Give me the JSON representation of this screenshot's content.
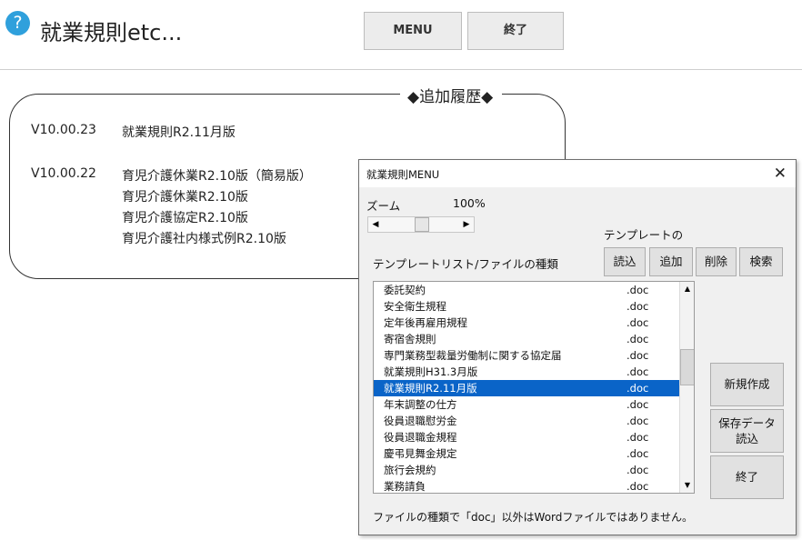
{
  "header": {
    "help_icon_glyph": "?",
    "title": "就業規則etc...",
    "menu_button": "MENU",
    "exit_button": "終了"
  },
  "history": {
    "title": "◆追加履歴◆",
    "entries": [
      {
        "version": "V10.00.23",
        "items": [
          "就業規則R2.11月版"
        ]
      },
      {
        "version": "V10.00.22",
        "items": [
          "育児介護休業R2.10版（簡易版）",
          "育児介護休業R2.10版",
          "育児介護協定R2.10版",
          "育児介護社内様式例R2.10版"
        ]
      }
    ]
  },
  "dialog": {
    "title": "就業規則MENU",
    "close_glyph": "✕",
    "zoom_label": "ズーム",
    "zoom_value": "100%",
    "zoom_left_arrow": "◀",
    "zoom_right_arrow": "▶",
    "template_group_label": "テンプレートの",
    "list_header": "テンプレートリスト/ファイルの種類",
    "buttons": {
      "read": "読込",
      "add": "追加",
      "delete": "削除",
      "search": "検索",
      "new": "新規作成",
      "load_saved_line1": "保存データ",
      "load_saved_line2": "読込",
      "close": "終了"
    },
    "list_up_arrow": "▲",
    "list_down_arrow": "▼",
    "list_items": [
      {
        "name": "委託契約",
        "ext": ".doc",
        "selected": false
      },
      {
        "name": "安全衛生規程",
        "ext": ".doc",
        "selected": false
      },
      {
        "name": "定年後再雇用規程",
        "ext": ".doc",
        "selected": false
      },
      {
        "name": "寄宿舎規則",
        "ext": ".doc",
        "selected": false
      },
      {
        "name": "専門業務型裁量労働制に関する協定届",
        "ext": ".doc",
        "selected": false
      },
      {
        "name": "就業規則H31.3月版",
        "ext": ".doc",
        "selected": false
      },
      {
        "name": "就業規則R2.11月版",
        "ext": ".doc",
        "selected": true
      },
      {
        "name": "年末調整の仕方",
        "ext": ".doc",
        "selected": false
      },
      {
        "name": "役員退職慰労金",
        "ext": ".doc",
        "selected": false
      },
      {
        "name": "役員退職金規程",
        "ext": ".doc",
        "selected": false
      },
      {
        "name": "慶弔見舞金規定",
        "ext": ".doc",
        "selected": false
      },
      {
        "name": "旅行会規約",
        "ext": ".doc",
        "selected": false
      },
      {
        "name": "業務請負",
        "ext": ".doc",
        "selected": false
      }
    ],
    "footer_note": "ファイルの種類で「doc」以外はWordファイルではありません。"
  }
}
